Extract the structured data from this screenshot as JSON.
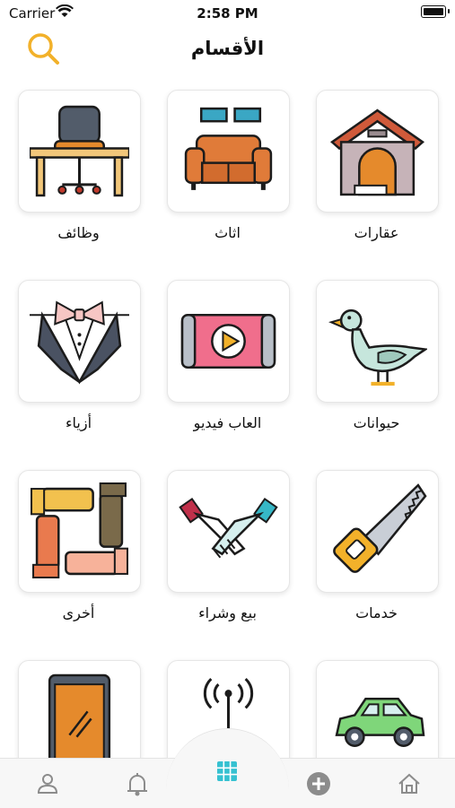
{
  "status_bar": {
    "carrier": "Carrier",
    "time": "2:58 PM"
  },
  "header": {
    "title": "الأقسام",
    "search_icon": "search-icon"
  },
  "categories": [
    {
      "label": "عقارات",
      "icon": "house-icon"
    },
    {
      "label": "اثاث",
      "icon": "sofa-icon"
    },
    {
      "label": "وظائف",
      "icon": "office-desk-icon"
    },
    {
      "label": "حيوانات",
      "icon": "duck-icon"
    },
    {
      "label": "العاب فيديو",
      "icon": "video-play-icon"
    },
    {
      "label": "أزياء",
      "icon": "tuxedo-icon"
    },
    {
      "label": "خدمات",
      "icon": "saw-icon"
    },
    {
      "label": "بيع وشراء",
      "icon": "handshake-icon"
    },
    {
      "label": "أخرى",
      "icon": "hands-square-icon"
    },
    {
      "label": "",
      "icon": "car-icon"
    },
    {
      "label": "",
      "icon": "antenna-icon"
    },
    {
      "label": "",
      "icon": "phone-icon"
    }
  ],
  "tabbar": {
    "tabs": [
      "profile-icon",
      "bell-icon",
      "grid-icon",
      "add-icon",
      "home-icon"
    ],
    "active": "grid-icon",
    "active_color": "#36c1d1"
  },
  "colors": {
    "accent": "#f2b12a",
    "text": "#111111"
  }
}
